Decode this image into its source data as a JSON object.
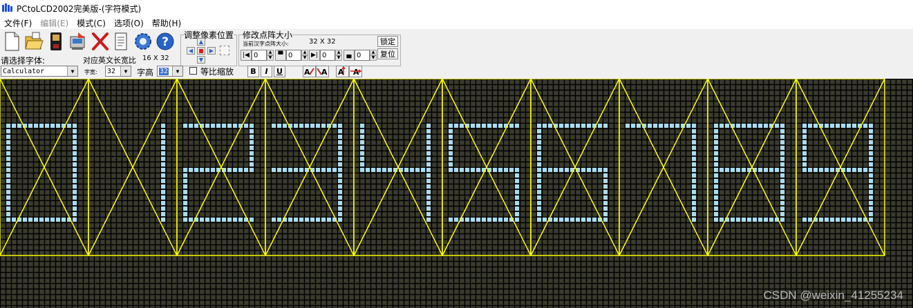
{
  "window": {
    "title": "PCtoLCD2002完美版-(字符模式)"
  },
  "menu": {
    "items": [
      {
        "label": "文件(F)",
        "enabled": true
      },
      {
        "label": "编辑(E)",
        "enabled": false
      },
      {
        "label": "模式(C)",
        "enabled": true
      },
      {
        "label": "选项(O)",
        "enabled": true
      },
      {
        "label": "帮助(H)",
        "enabled": true
      }
    ]
  },
  "toolbar": {
    "icons": [
      "new-icon",
      "open-icon",
      "save-icon",
      "export-icon",
      "delete-icon",
      "document-icon",
      "settings-icon",
      "help-icon"
    ]
  },
  "adjust_group": {
    "title": "调整像素位置"
  },
  "resize_group": {
    "title": "修改点阵大小",
    "current_label": "当前汉字点阵大小:",
    "current_size": "32 X 32",
    "lock_label": "锁定",
    "restore_label": "复位",
    "spin_values": [
      "0",
      "0",
      "0",
      "0"
    ]
  },
  "font_panel": {
    "font_label": "请选择字体:",
    "font_name": "Calculator",
    "ratio_label": "对应英文长宽比",
    "ratio_value": "16 X 32",
    "width_label": "字宽:",
    "width_value": "32",
    "height_label": "字高",
    "height_value": "32",
    "proportional_label": "等比缩放",
    "proportional_checked": false,
    "bold_label": "B",
    "italic_label": "I",
    "underline_label": "U"
  },
  "canvas": {
    "text": "0123456789",
    "cols": 1321,
    "background": "#3a3a2e",
    "grid_color": "#000000",
    "pixel_on_color": "#a9dcf2",
    "guide_color": "#ffff00"
  },
  "watermark": {
    "text": "CSDN @weixin_41255234"
  },
  "colors": {
    "title_icon": "#1a4fd6",
    "selection": "#3a6fd8"
  }
}
